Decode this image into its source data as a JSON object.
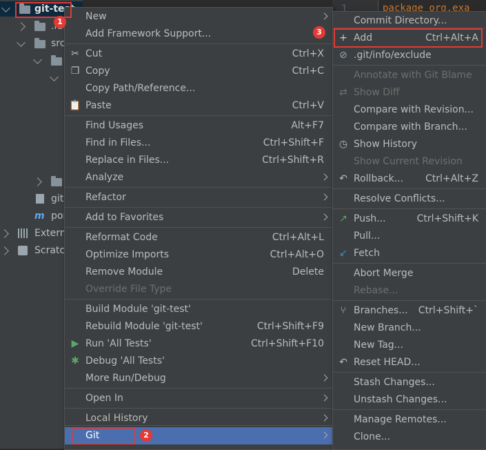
{
  "tree": {
    "root_label": "git-test",
    "rows": [
      ".idea",
      "src",
      "",
      "",
      "",
      "git.",
      "pom",
      "External",
      "Scratch"
    ]
  },
  "editor": {
    "gutter_number": "1",
    "code": "package org.exa"
  },
  "context_menu": {
    "items": [
      {
        "label": "New",
        "shortcut": "",
        "submenu": true
      },
      {
        "label": "Add Framework Support...",
        "shortcut": ""
      },
      {
        "label": "Cut",
        "shortcut": "Ctrl+X",
        "icon": "cut-icon"
      },
      {
        "label": "Copy",
        "shortcut": "Ctrl+C",
        "icon": "copy-icon"
      },
      {
        "label": "Copy Path/Reference...",
        "shortcut": ""
      },
      {
        "label": "Paste",
        "shortcut": "Ctrl+V",
        "icon": "paste-icon"
      },
      {
        "label": "Find Usages",
        "shortcut": "Alt+F7"
      },
      {
        "label": "Find in Files...",
        "shortcut": "Ctrl+Shift+F"
      },
      {
        "label": "Replace in Files...",
        "shortcut": "Ctrl+Shift+R"
      },
      {
        "label": "Analyze",
        "shortcut": "",
        "submenu": true
      },
      {
        "label": "Refactor",
        "shortcut": "",
        "submenu": true
      },
      {
        "label": "Add to Favorites",
        "shortcut": "",
        "submenu": true
      },
      {
        "label": "Reformat Code",
        "shortcut": "Ctrl+Alt+L"
      },
      {
        "label": "Optimize Imports",
        "shortcut": "Ctrl+Alt+O"
      },
      {
        "label": "Remove Module",
        "shortcut": "Delete"
      },
      {
        "label": "Override File Type",
        "shortcut": "",
        "disabled": true
      },
      {
        "label": "Build Module 'git-test'",
        "shortcut": ""
      },
      {
        "label": "Rebuild Module 'git-test'",
        "shortcut": "Ctrl+Shift+F9"
      },
      {
        "label": "Run 'All Tests'",
        "shortcut": "Ctrl+Shift+F10",
        "icon": "run-icon"
      },
      {
        "label": "Debug 'All Tests'",
        "shortcut": "",
        "icon": "debug-icon"
      },
      {
        "label": "More Run/Debug",
        "shortcut": "",
        "submenu": true
      },
      {
        "label": "Open In",
        "shortcut": "",
        "submenu": true
      },
      {
        "label": "Local History",
        "shortcut": "",
        "submenu": true
      },
      {
        "label": "Git",
        "shortcut": "",
        "submenu": true,
        "selected": true
      }
    ]
  },
  "git_menu": {
    "items": [
      {
        "label": "Commit Directory...",
        "shortcut": ""
      },
      {
        "label": "Add",
        "shortcut": "Ctrl+Alt+A",
        "icon": "plus-icon"
      },
      {
        "label": ".git/info/exclude",
        "shortcut": "",
        "icon": "ignore-file-icon"
      },
      {
        "label": "Annotate with Git Blame",
        "shortcut": "",
        "disabled": true
      },
      {
        "label": "Show Diff",
        "shortcut": "",
        "disabled": true,
        "icon": "diff-icon"
      },
      {
        "label": "Compare with Revision...",
        "shortcut": ""
      },
      {
        "label": "Compare with Branch...",
        "shortcut": ""
      },
      {
        "label": "Show History",
        "shortcut": "",
        "icon": "history-icon"
      },
      {
        "label": "Show Current Revision",
        "shortcut": "",
        "disabled": true
      },
      {
        "label": "Rollback...",
        "shortcut": "Ctrl+Alt+Z",
        "icon": "rollback-icon"
      },
      {
        "label": "Resolve Conflicts...",
        "shortcut": ""
      },
      {
        "label": "Push...",
        "shortcut": "Ctrl+Shift+K",
        "icon": "push-icon"
      },
      {
        "label": "Pull...",
        "shortcut": ""
      },
      {
        "label": "Fetch",
        "shortcut": "",
        "icon": "fetch-icon"
      },
      {
        "label": "Abort Merge",
        "shortcut": ""
      },
      {
        "label": "Rebase...",
        "shortcut": "",
        "disabled": true
      },
      {
        "label": "Branches...",
        "shortcut": "Ctrl+Shift+`",
        "icon": "branch-icon"
      },
      {
        "label": "New Branch...",
        "shortcut": ""
      },
      {
        "label": "New Tag...",
        "shortcut": ""
      },
      {
        "label": "Reset HEAD...",
        "shortcut": "",
        "icon": "reset-icon"
      },
      {
        "label": "Stash Changes...",
        "shortcut": ""
      },
      {
        "label": "Unstash Changes...",
        "shortcut": ""
      },
      {
        "label": "Manage Remotes...",
        "shortcut": ""
      },
      {
        "label": "Clone...",
        "shortcut": ""
      }
    ]
  },
  "badges": [
    "1",
    "2",
    "3"
  ],
  "colors": {
    "highlight": "#e53935",
    "selection": "#4b6eaf"
  }
}
